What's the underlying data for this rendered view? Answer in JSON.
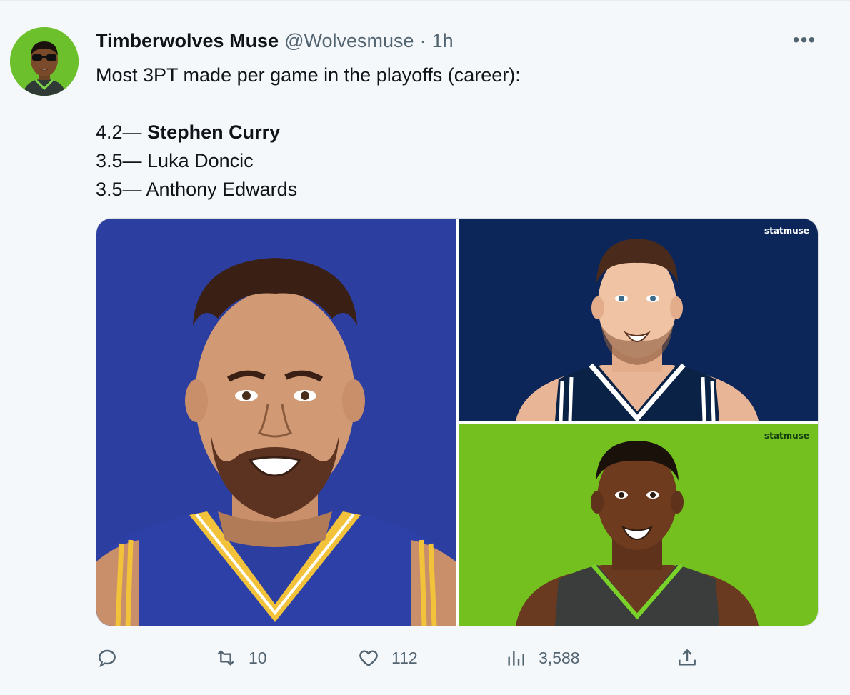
{
  "tweet": {
    "author_name": "Timberwolves Muse",
    "author_handle": "@Wolvesmuse",
    "separator": "·",
    "time": "1h",
    "more_label": "•••",
    "lines": {
      "intro": "Most 3PT made per game in the playoffs (career):",
      "r1_value": "4.2—",
      "r1_name": "Stephen Curry",
      "r2": "3.5— Luka Doncic",
      "r3": "3.5— Anthony Edwards"
    }
  },
  "media": {
    "watermark_top": "statmuse",
    "watermark_bottom": "statmuse",
    "colors": {
      "curry_bg": "#2d3ea1",
      "luka_bg": "#0c2659",
      "ant_bg": "#73c01e"
    }
  },
  "actions": {
    "reply": {
      "icon": "reply-icon",
      "count": ""
    },
    "retweet": {
      "icon": "retweet-icon",
      "count": "10"
    },
    "like": {
      "icon": "heart-icon",
      "count": "112"
    },
    "views": {
      "icon": "views-icon",
      "count": "3,588"
    },
    "share": {
      "icon": "share-icon",
      "count": ""
    }
  }
}
